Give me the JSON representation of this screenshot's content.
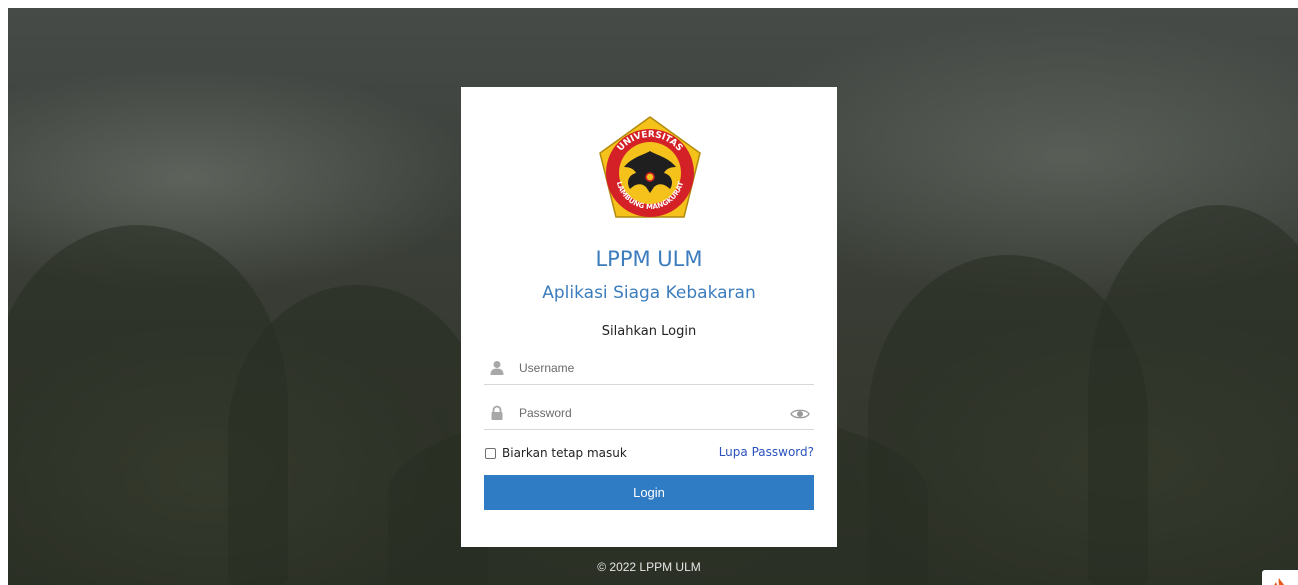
{
  "login": {
    "title": "LPPM ULM",
    "subtitle": "Aplikasi Siaga Kebakaran",
    "prompt": "Silahkan Login",
    "username_placeholder": "Username",
    "password_placeholder": "Password",
    "remember_label": "Biarkan tetap masuk",
    "remember_checked": false,
    "forgot_label": "Lupa Password?",
    "submit_label": "Login"
  },
  "footer": {
    "copyright": "© 2022 LPPM ULM"
  },
  "logo": {
    "top_text": "UNIVERSITAS",
    "bottom_text": "LAMBUNG MANGKURAT"
  },
  "colors": {
    "accent": "#3d7dbd",
    "button": "#2f7cc4",
    "link": "#2a52be",
    "logo_yellow": "#f4c21b",
    "logo_red": "#d42027"
  },
  "icons": {
    "username": "user-icon",
    "password": "lock-icon",
    "toggle_password": "eye-icon",
    "corner": "flame-icon"
  }
}
